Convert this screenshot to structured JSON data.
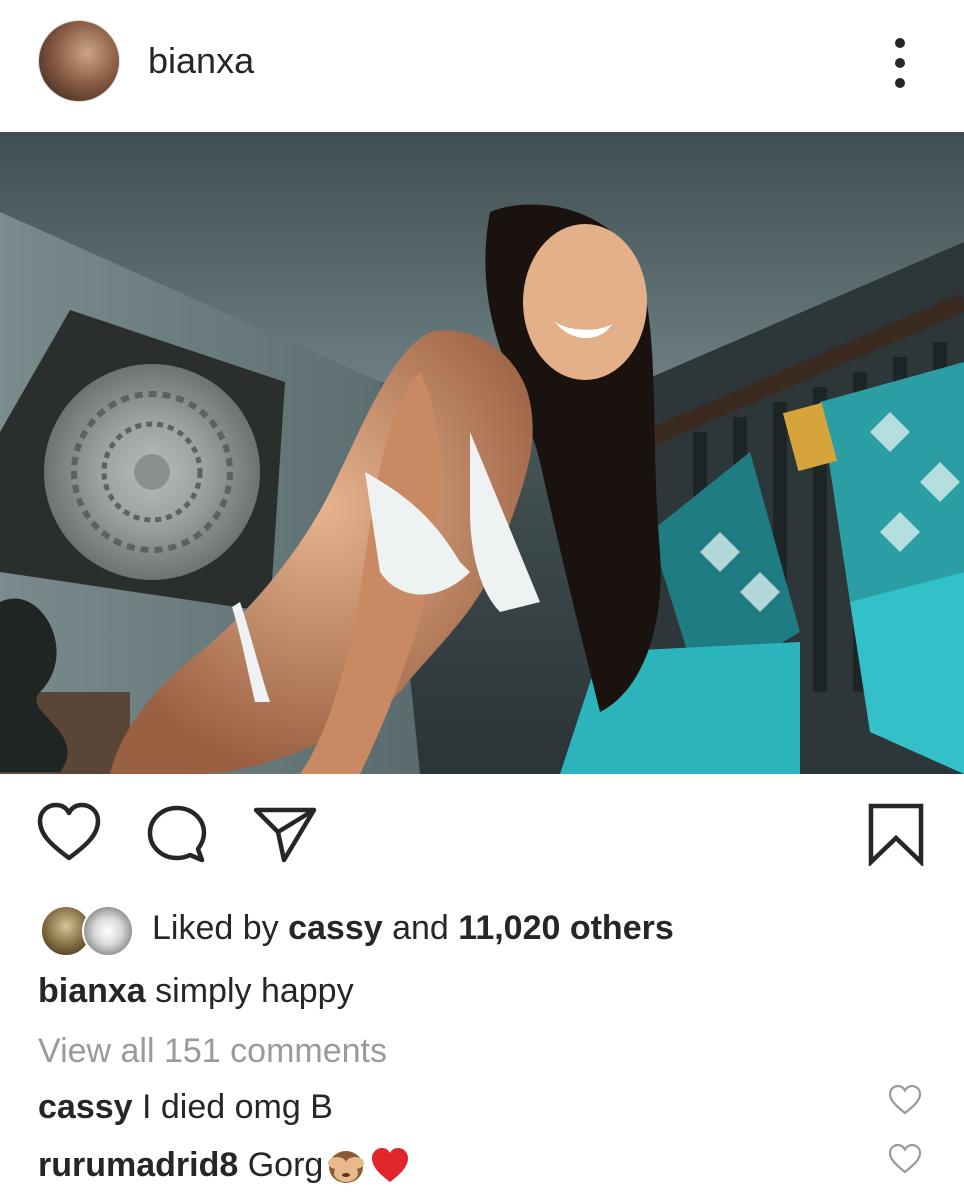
{
  "post": {
    "username": "bianxa",
    "likes": {
      "prefix": "Liked by",
      "user": "cassy",
      "middle": "and",
      "count": "11,020 others"
    },
    "caption": {
      "user": "bianxa",
      "text": "simply happy"
    },
    "view_all_comments": "View all 151 comments",
    "comments": [
      {
        "user": "cassy",
        "text": "I died omg B"
      },
      {
        "user": "rurumadrid8",
        "text": "Gorg"
      }
    ]
  },
  "icons": {
    "more": "more-vertical-icon",
    "like": "heart-icon",
    "comment": "comment-icon",
    "share": "paper-plane-icon",
    "save": "bookmark-icon",
    "comment_like": "heart-outline-icon",
    "emoji_1": "see-no-evil-monkey-emoji",
    "emoji_2": "red-heart-emoji"
  },
  "colors": {
    "text": "#262626",
    "muted": "#9a9a9a",
    "heart_red": "#e0262a"
  }
}
